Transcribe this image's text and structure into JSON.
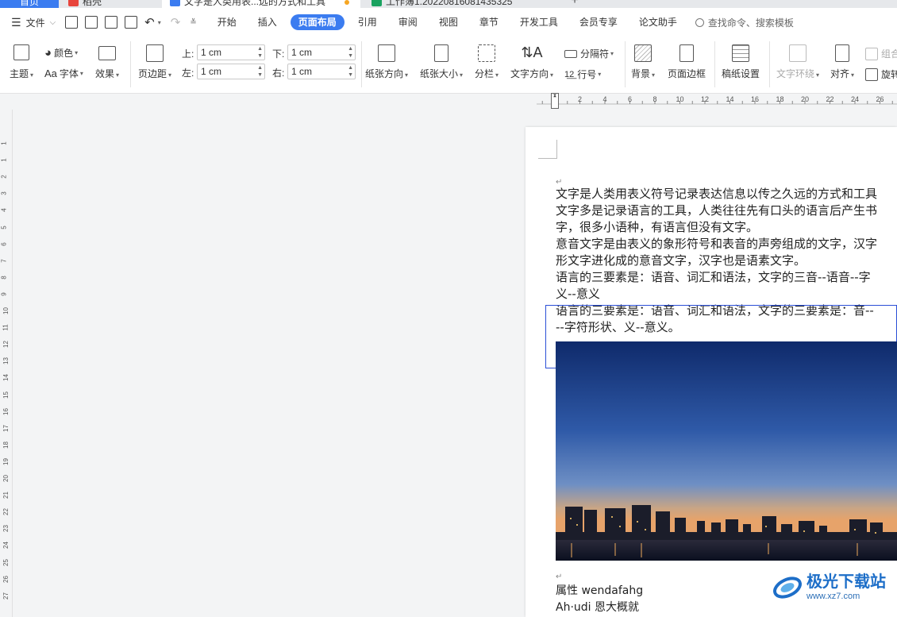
{
  "tabs": [
    {
      "label": "首页"
    },
    {
      "label": "稻壳"
    },
    {
      "label": "文字是人类用表...远的方式和工具"
    },
    {
      "label": "工作簿1.20220816081435325"
    }
  ],
  "new_tab": "+",
  "menu": {
    "file": "文件",
    "tabs": [
      "开始",
      "插入",
      "页面布局",
      "引用",
      "审阅",
      "视图",
      "章节",
      "开发工具",
      "会员专享",
      "论文助手"
    ],
    "active_tab": "页面布局",
    "search_placeholder": "查找命令、搜索模板"
  },
  "ribbon": {
    "theme": "主题",
    "color": "颜色",
    "font": "字体",
    "effect": "效果",
    "margin": "页边距",
    "top_label": "上:",
    "top_value": "1 cm",
    "bottom_label": "下:",
    "bottom_value": "1 cm",
    "left_label": "左:",
    "left_value": "1 cm",
    "right_label": "右:",
    "right_value": "1 cm",
    "orientation": "纸张方向",
    "size": "纸张大小",
    "columns": "分栏",
    "direction": "文字方向",
    "separator": "分隔符",
    "line_number": "行号",
    "background": "背景",
    "border": "页面边框",
    "manuscript": "稿纸设置",
    "wrap": "文字环绕",
    "align": "对齐",
    "group": "组合",
    "rotate": "旋转"
  },
  "ruler": {
    "h_ticks": [
      "2",
      "4",
      "6",
      "8",
      "10",
      "12",
      "14",
      "16",
      "18",
      "20",
      "22",
      "24",
      "26"
    ],
    "v_ticks": [
      "1",
      "1",
      "2",
      "3",
      "4",
      "5",
      "6",
      "7",
      "8",
      "9",
      "10",
      "11",
      "12",
      "13",
      "14",
      "15",
      "16",
      "17",
      "18",
      "19",
      "20",
      "21",
      "22",
      "23",
      "24",
      "25",
      "26",
      "27"
    ]
  },
  "document": {
    "lines": [
      "文字是人类用表义符号记录表达信息以传之久远的方式和工具",
      "文字多是记录语言的工具，人类往往先有口头的语言后产生书",
      "字，很多小语种，有语言但没有文字。",
      "意音文字是由表义的象形符号和表音的声旁组成的文字，汉字",
      "形文字进化成的意音文字，汉字也是语素文字。",
      "语言的三要素是：语音、词汇和语法，文字的三音--语音--字",
      "义--意义",
      "语言的三要素是：语音、词汇和语法，文字的三要素是：音--",
      "--字符形状、义--意义。"
    ],
    "bottom_line1": "属性 wendafahg",
    "bottom_line2": "Ah·udi 恩大概就",
    "paragraph_mark": "↵"
  },
  "watermark": {
    "brand": "极光下载站",
    "url": "www.xz7.com"
  },
  "colors": {
    "accent": "#3b7cf0",
    "selection": "#2b4fd6"
  }
}
